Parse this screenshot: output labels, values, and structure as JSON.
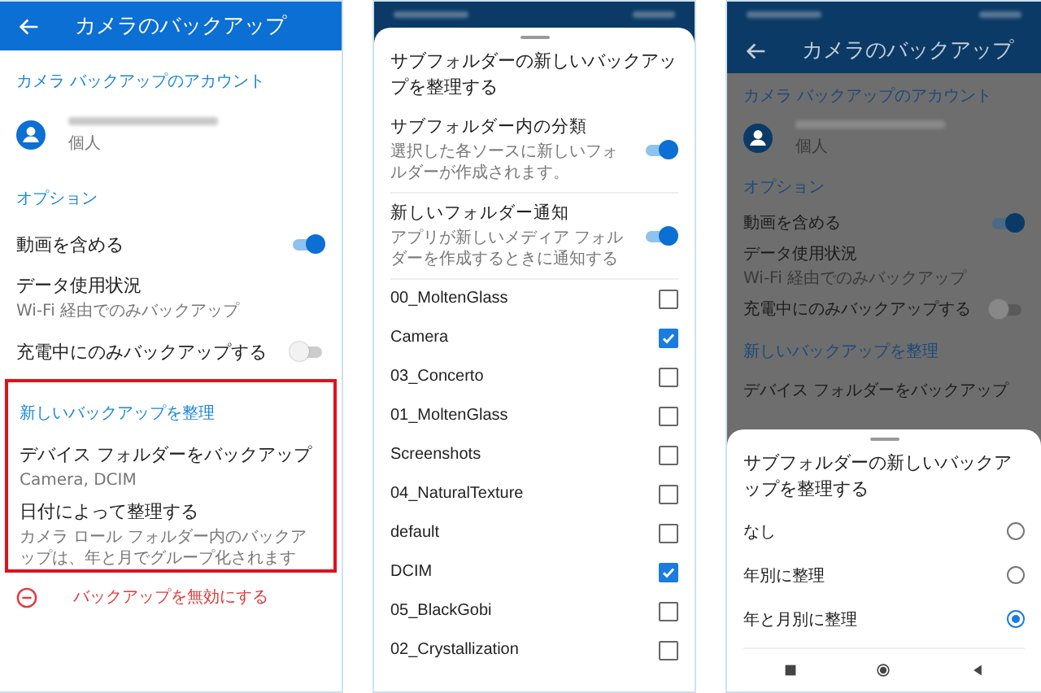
{
  "settings_screen": {
    "title": "カメラのバックアップ",
    "sections": [
      {
        "header": "カメラ バックアップのアカウント",
        "highlighted": false,
        "items": [
          {
            "kind": "account",
            "subtitle": "個人"
          }
        ]
      },
      {
        "header": "オプション",
        "highlighted": false,
        "items": [
          {
            "kind": "toggle",
            "label": "動画を含める",
            "on": true
          },
          {
            "kind": "text",
            "label": "データ使用状況",
            "subtitle": "Wi-Fi 経由でのみバックアップ"
          },
          {
            "kind": "toggle",
            "label": "充電中にのみバックアップする",
            "on": false
          }
        ]
      },
      {
        "header": "新しいバックアップを整理",
        "highlighted": true,
        "items": [
          {
            "kind": "text",
            "label": "デバイス フォルダーをバックアップ",
            "subtitle": "Camera, DCIM"
          },
          {
            "kind": "text",
            "label": "日付によって整理する",
            "subtitle": "カメラ ロール フォルダー内のバックアップは、年と月でグループ化されます"
          }
        ]
      }
    ],
    "disable_action": "バックアップを無効にする"
  },
  "subfolder_sheet": {
    "title": "サブフォルダーの新しいバックアップを整理する",
    "toggles": [
      {
        "label": "サブフォルダー内の分類",
        "subtitle": "選択した各ソースに新しいフォルダーが作成されます。",
        "on": true
      },
      {
        "label": "新しいフォルダー通知",
        "subtitle": "アプリが新しいメディア フォルダーを作成するときに通知する",
        "on": true
      }
    ],
    "folders": [
      {
        "name": "00_MoltenGlass",
        "checked": false
      },
      {
        "name": "Camera",
        "checked": true
      },
      {
        "name": "03_Concerto",
        "checked": false
      },
      {
        "name": "01_MoltenGlass",
        "checked": false
      },
      {
        "name": "Screenshots",
        "checked": false
      },
      {
        "name": "04_NaturalTexture",
        "checked": false
      },
      {
        "name": "default",
        "checked": false
      },
      {
        "name": "DCIM",
        "checked": true
      },
      {
        "name": "05_BlackGobi",
        "checked": false
      },
      {
        "name": "02_Crystallization",
        "checked": false
      }
    ]
  },
  "organize_screen": {
    "background": {
      "title": "カメラのバックアップ",
      "sections": [
        {
          "header": "カメラ バックアップのアカウント",
          "highlighted": false,
          "items": [
            {
              "kind": "account",
              "subtitle": "個人"
            }
          ]
        },
        {
          "header": "オプション",
          "highlighted": false,
          "items": [
            {
              "kind": "toggle",
              "label": "動画を含める",
              "on": true
            },
            {
              "kind": "text",
              "label": "データ使用状況",
              "subtitle": "Wi-Fi 経由でのみバックアップ"
            },
            {
              "kind": "toggle",
              "label": "充電中にのみバックアップする",
              "on": false
            }
          ]
        },
        {
          "header": "新しいバックアップを整理",
          "highlighted": false,
          "items": [
            {
              "kind": "text",
              "label": "デバイス フォルダーをバックアップ"
            }
          ]
        }
      ]
    },
    "sheet": {
      "title": "サブフォルダーの新しいバックアップを整理する",
      "options": [
        {
          "label": "なし",
          "selected": false
        },
        {
          "label": "年別に整理",
          "selected": false
        },
        {
          "label": "年と月別に整理",
          "selected": true
        }
      ]
    }
  }
}
